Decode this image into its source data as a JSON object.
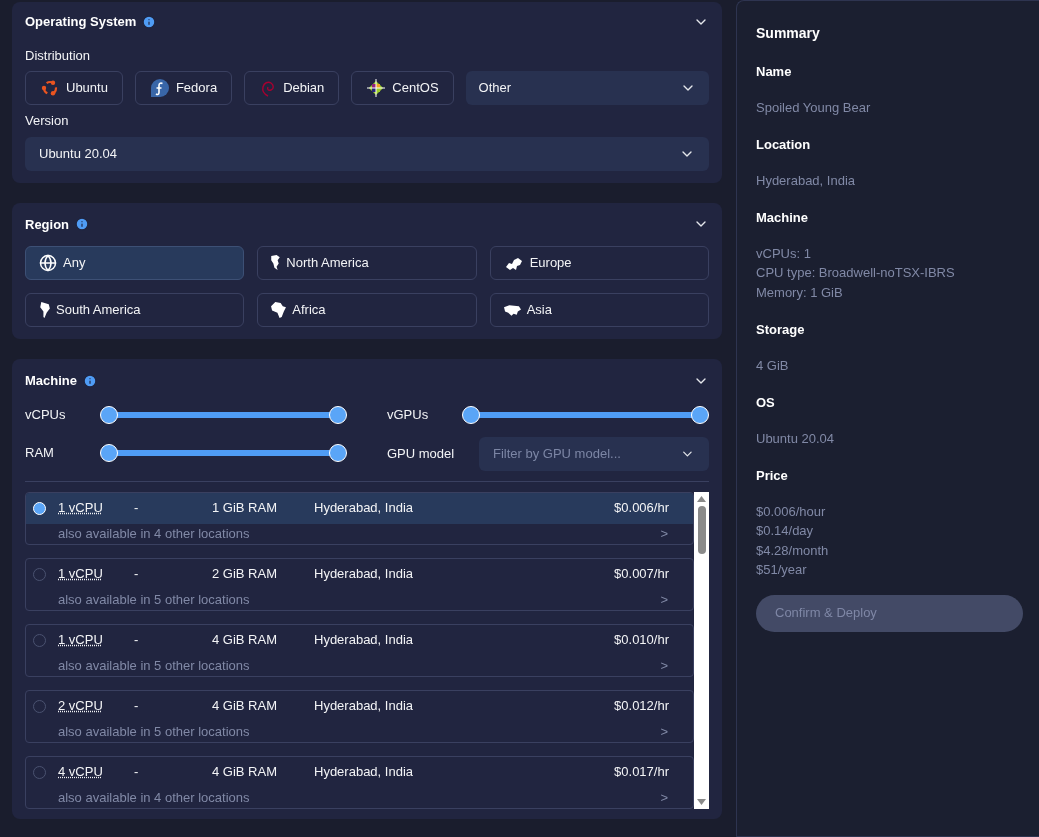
{
  "os_panel": {
    "title": "Operating System",
    "distribution_label": "Distribution",
    "distributions": [
      {
        "label": "Ubuntu",
        "kind": "ubuntu",
        "selected": false
      },
      {
        "label": "Fedora",
        "kind": "fedora",
        "selected": false
      },
      {
        "label": "Debian",
        "kind": "debian",
        "selected": false
      },
      {
        "label": "CentOS",
        "kind": "centos",
        "selected": false
      }
    ],
    "other_select": {
      "value": "Other"
    },
    "version_label": "Version",
    "version_select": {
      "value": "Ubuntu 20.04"
    }
  },
  "region_panel": {
    "title": "Region",
    "regions": [
      {
        "label": "Any",
        "kind": "globe",
        "selected": true
      },
      {
        "label": "North America",
        "kind": "north-america",
        "selected": false
      },
      {
        "label": "Europe",
        "kind": "europe",
        "selected": false
      },
      {
        "label": "South America",
        "kind": "south-america",
        "selected": false
      },
      {
        "label": "Africa",
        "kind": "africa",
        "selected": false
      },
      {
        "label": "Asia",
        "kind": "asia",
        "selected": false
      }
    ]
  },
  "machine_panel": {
    "title": "Machine",
    "sliders": [
      {
        "label": "vCPUs",
        "level": 1
      },
      {
        "label": "vGPUs",
        "level": 1
      },
      {
        "label": "RAM",
        "level": 1
      }
    ],
    "gpu_model": {
      "label": "GPU model",
      "placeholder": "Filter by GPU model..."
    },
    "plans": [
      {
        "vcpu": "1 vCPU",
        "dash": "-",
        "ram": "1 GiB RAM",
        "location": "Hyderabad, India",
        "price": "$0.006/hr",
        "availability": "also available in 4 other locations",
        "more": ">",
        "selected": true
      },
      {
        "vcpu": "1 vCPU",
        "dash": "-",
        "ram": "2 GiB RAM",
        "location": "Hyderabad, India",
        "price": "$0.007/hr",
        "availability": "also available in 5 other locations",
        "more": ">",
        "selected": false
      },
      {
        "vcpu": "1 vCPU",
        "dash": "-",
        "ram": "4 GiB RAM",
        "location": "Hyderabad, India",
        "price": "$0.010/hr",
        "availability": "also available in 5 other locations",
        "more": ">",
        "selected": false
      },
      {
        "vcpu": "2 vCPU",
        "dash": "-",
        "ram": "4 GiB RAM",
        "location": "Hyderabad, India",
        "price": "$0.012/hr",
        "availability": "also available in 5 other locations",
        "more": ">",
        "selected": false
      },
      {
        "vcpu": "4 vCPU",
        "dash": "-",
        "ram": "4 GiB RAM",
        "location": "Hyderabad, India",
        "price": "$0.017/hr",
        "availability": "also available in 4 other locations",
        "more": ">",
        "selected": false
      }
    ]
  },
  "summary": {
    "title": "Summary",
    "sections": [
      {
        "heading": "Name",
        "lines": [
          "Spoiled Young Bear"
        ]
      },
      {
        "heading": "Location",
        "lines": [
          "Hyderabad, India"
        ]
      },
      {
        "heading": "Machine",
        "lines": [
          "vCPUs: 1",
          "CPU type: Broadwell-noTSX-IBRS",
          "Memory: 1 GiB"
        ]
      },
      {
        "heading": "Storage",
        "lines": [
          "4 GiB"
        ]
      },
      {
        "heading": "OS",
        "lines": [
          "Ubuntu 20.04"
        ]
      },
      {
        "heading": "Price",
        "lines": [
          "$0.006/hour",
          "$0.14/day",
          "$4.28/month",
          "$51/year"
        ]
      }
    ],
    "confirm_button": {
      "label": "Confirm & Deploy",
      "disabled": true
    }
  }
}
